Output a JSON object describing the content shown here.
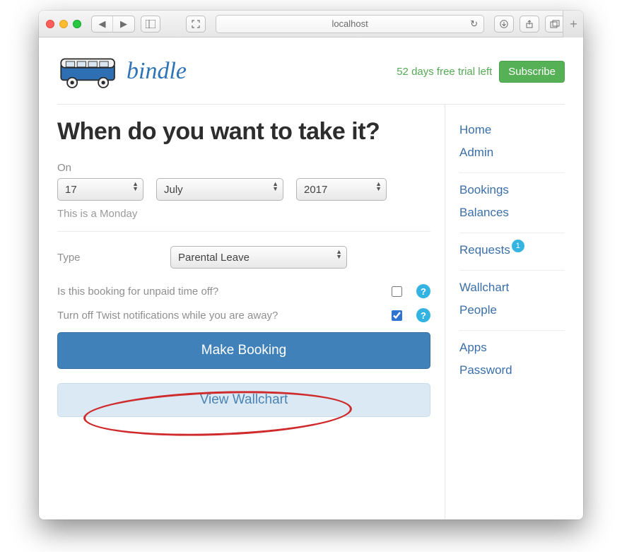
{
  "browser": {
    "url": "localhost"
  },
  "header": {
    "brand": "bindle",
    "trial_text": "52 days free trial left",
    "subscribe_label": "Subscribe"
  },
  "main": {
    "title": "When do you want to take it?",
    "on_label": "On",
    "day": "17",
    "month": "July",
    "year": "2017",
    "day_hint": "This is a Monday",
    "type_label": "Type",
    "type_value": "Parental Leave",
    "unpaid_label": "Is this booking for unpaid time off?",
    "unpaid_checked": false,
    "twist_label": "Turn off Twist notifications while you are away?",
    "twist_checked": true,
    "make_booking_label": "Make Booking",
    "view_wallchart_label": "View Wallchart"
  },
  "sidebar": {
    "group1": [
      "Home",
      "Admin"
    ],
    "group2": [
      "Bookings",
      "Balances"
    ],
    "group3_item": "Requests",
    "group3_badge": "1",
    "group4": [
      "Wallchart",
      "People"
    ],
    "group5": [
      "Apps",
      "Password"
    ]
  }
}
